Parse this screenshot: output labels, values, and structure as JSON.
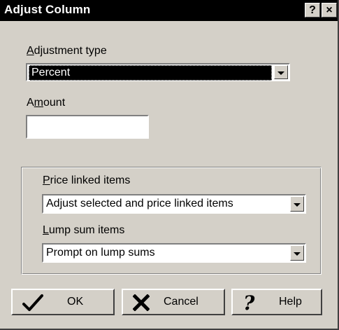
{
  "window": {
    "title": "Adjust Column",
    "help_glyph": "?",
    "close_glyph": "×"
  },
  "adjustment_type": {
    "label_underline": "A",
    "label_rest": "djustment type",
    "value": "Percent"
  },
  "amount": {
    "label_pre": "A",
    "label_underline": "m",
    "label_rest": "ount",
    "value": ""
  },
  "price_linked": {
    "label_underline": "P",
    "label_rest": "rice linked items",
    "value": "Adjust selected and price linked items"
  },
  "lump_sum": {
    "label_underline": "L",
    "label_rest": "ump sum items",
    "value": "Prompt on lump sums"
  },
  "buttons": {
    "ok": "OK",
    "cancel": "Cancel",
    "help": "Help"
  },
  "icons": {
    "ok": "checkmark-icon",
    "cancel": "x-icon",
    "help": "question-mark-icon"
  }
}
